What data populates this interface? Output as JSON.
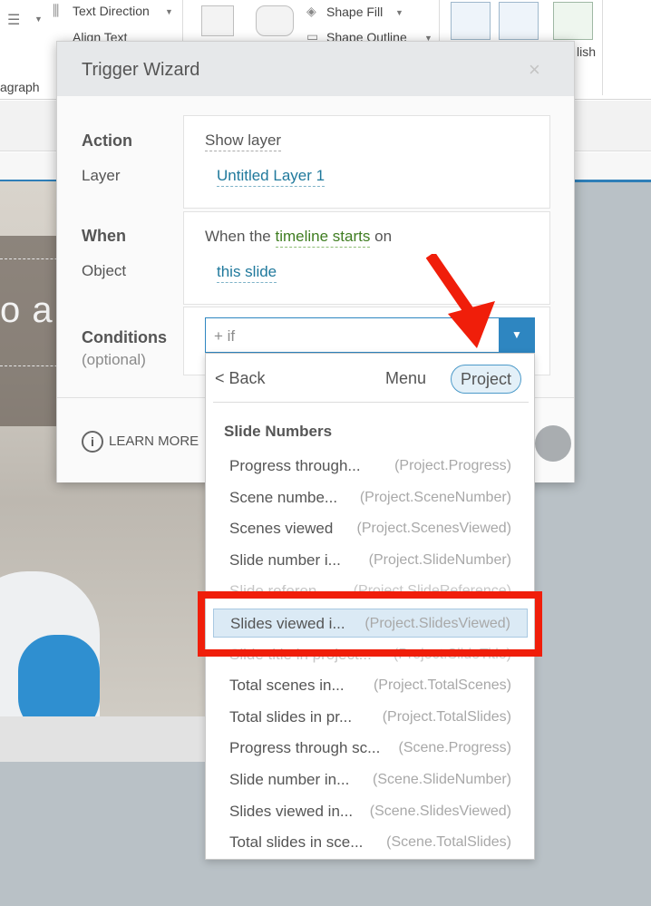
{
  "ribbon": {
    "text_direction": "Text Direction",
    "align_text": "Align Text",
    "shape_fill": "Shape Fill",
    "shape_outline": "Shape Outline",
    "paragraph_group": "agraph",
    "publish_group": "lish"
  },
  "slide": {
    "title_fragment": "o a"
  },
  "dialog": {
    "title": "Trigger Wizard",
    "close_symbol": "×",
    "action": {
      "label": "Action",
      "value": "Show layer"
    },
    "layer": {
      "label": "Layer",
      "value": "Untitled Layer 1"
    },
    "when": {
      "label": "When",
      "prefix": "When the",
      "value": "timeline starts",
      "suffix": "on"
    },
    "object": {
      "label": "Object",
      "value": "this slide"
    },
    "conditions": {
      "label": "Conditions",
      "sublabel": "(optional)",
      "value": "+ if",
      "caret": "▼"
    },
    "footer": {
      "info_glyph": "i",
      "learn_more": "LEARN MORE"
    }
  },
  "dropdown": {
    "back": "< Back",
    "menu": "Menu",
    "project": "Project",
    "section": "Slide Numbers",
    "items": [
      {
        "name": "Progress through...",
        "var": "(Project.Progress)"
      },
      {
        "name": "Scene numbe...",
        "var": "(Project.SceneNumber)"
      },
      {
        "name": "Scenes viewed",
        "var": "(Project.ScenesViewed)"
      },
      {
        "name": "Slide number i...",
        "var": "(Project.SlideNumber)"
      },
      {
        "name": "Slide referen...",
        "var": "(Project.SlideReference)"
      },
      {
        "name": "Slides viewed i...",
        "var": "(Project.SlidesViewed)"
      },
      {
        "name": "Slide title in project...",
        "var": "(Project.SlideTitle)"
      },
      {
        "name": "Total scenes in...",
        "var": "(Project.TotalScenes)"
      },
      {
        "name": "Total slides in pr...",
        "var": "(Project.TotalSlides)"
      },
      {
        "name": "Progress through sc...",
        "var": "(Scene.Progress)"
      },
      {
        "name": "Slide number in...",
        "var": "(Scene.SlideNumber)"
      },
      {
        "name": "Slides viewed in...",
        "var": "(Scene.SlidesViewed)"
      },
      {
        "name": "Total slides in sce...",
        "var": "(Scene.TotalSlides)"
      }
    ],
    "selected_index": 5
  },
  "colors": {
    "accent": "#2e86c1",
    "highlight_annotation": "#f01e0a",
    "link": "#20799c",
    "link_green": "#3f7d21"
  }
}
